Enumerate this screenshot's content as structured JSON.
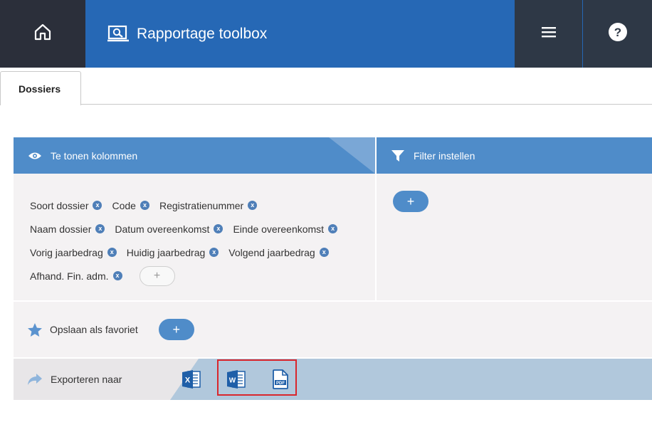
{
  "header": {
    "title": "Rapportage toolbox",
    "home_icon": "home-icon",
    "brand_icon": "monitor-search-icon",
    "menu_icon": "hamburger-icon",
    "help_icon": "help-icon"
  },
  "tabs": [
    {
      "label": "Dossiers",
      "active": true
    }
  ],
  "columns_panel": {
    "title": "Te tonen kolommen",
    "icon": "eye-icon",
    "chip_rows": [
      [
        "Soort dossier",
        "Code",
        "Registratienummer"
      ],
      [
        "Naam dossier",
        "Datum overeenkomst",
        "Einde overeenkomst"
      ],
      [
        "Vorig jaarbedrag",
        "Huidig jaarbedrag",
        "Volgend jaarbedrag"
      ],
      [
        "Afhand. Fin. adm."
      ]
    ],
    "remove_glyph": "x",
    "add_glyph": "+"
  },
  "filter_panel": {
    "title": "Filter instellen",
    "icon": "filter-icon",
    "add_glyph": "+"
  },
  "favorite": {
    "label": "Opslaan als favoriet",
    "icon": "star-icon",
    "add_glyph": "+"
  },
  "export": {
    "label": "Exporteren naar",
    "icon": "share-arrow-icon",
    "formats": [
      "excel",
      "word",
      "pdf"
    ]
  },
  "colors": {
    "topbar": "#2668b5",
    "dark": "#2b2f3a",
    "panel_head": "#4f8cc9",
    "panel_body": "#f4f2f3",
    "highlight": "#d9262c"
  }
}
